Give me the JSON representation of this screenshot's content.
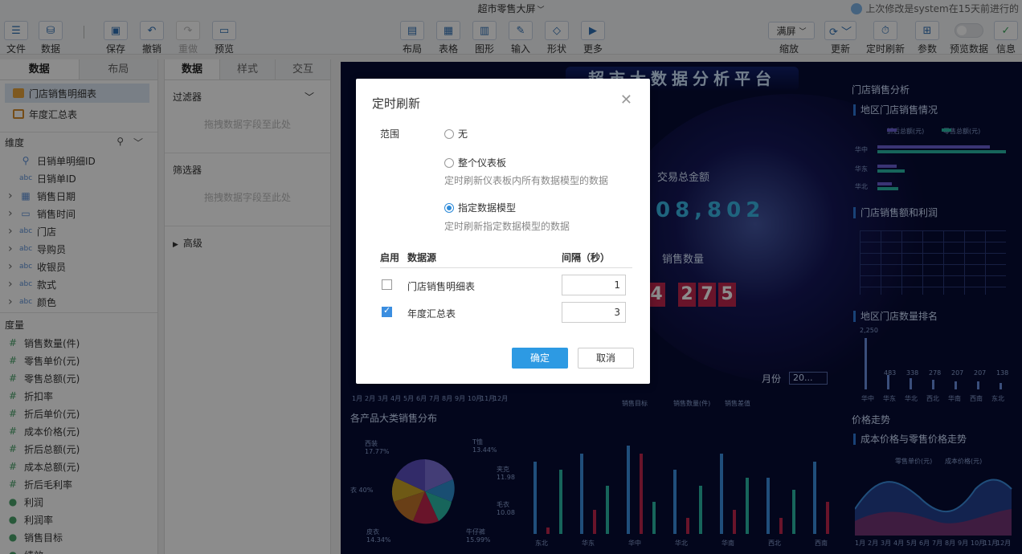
{
  "app_title": "超市零售大屏",
  "last_modified": "上次修改是system在15天前进行的",
  "toolbar_left": [
    {
      "id": "file",
      "label": "文件",
      "icon": "menu-icon"
    },
    {
      "id": "data",
      "label": "数据",
      "icon": "database-icon"
    },
    {
      "id": "save",
      "label": "保存",
      "icon": "save-icon"
    },
    {
      "id": "undo",
      "label": "撤销",
      "icon": "undo-icon"
    },
    {
      "id": "redo",
      "label": "重做",
      "icon": "redo-icon",
      "disabled": true
    },
    {
      "id": "preview",
      "label": "预览",
      "icon": "monitor-icon"
    }
  ],
  "toolbar_mid": [
    {
      "id": "layout",
      "label": "布局"
    },
    {
      "id": "table",
      "label": "表格"
    },
    {
      "id": "chart",
      "label": "图形"
    },
    {
      "id": "input",
      "label": "输入"
    },
    {
      "id": "shape",
      "label": "形状"
    },
    {
      "id": "more",
      "label": "更多"
    }
  ],
  "toolbar_right": {
    "zoom_value": "满屏",
    "zoom_label": "缩放",
    "refresh_label": "更新",
    "timed_refresh_label": "定时刷新",
    "params_label": "参数",
    "preview_data_label": "预览数据",
    "info_label": "信息"
  },
  "left_panel": {
    "tabs": [
      "数据",
      "布局"
    ],
    "datasources": [
      "门店销售明细表",
      "年度汇总表"
    ],
    "dimension_header": "维度",
    "dimensions": [
      {
        "label": "日销单明细ID",
        "type": "key",
        "expand": false
      },
      {
        "label": "日销单ID",
        "type": "abc",
        "expand": false
      },
      {
        "label": "销售日期",
        "type": "date",
        "expand": true
      },
      {
        "label": "销售时间",
        "type": "time",
        "expand": true
      },
      {
        "label": "门店",
        "type": "abc",
        "expand": true
      },
      {
        "label": "导购员",
        "type": "abc",
        "expand": true
      },
      {
        "label": "收银员",
        "type": "abc",
        "expand": true
      },
      {
        "label": "款式",
        "type": "abc",
        "expand": true
      },
      {
        "label": "颜色",
        "type": "abc",
        "expand": true
      }
    ],
    "measure_header": "度量",
    "measures": [
      "销售数量(件)",
      "零售单价(元)",
      "零售总额(元)",
      "折扣率",
      "折后单价(元)",
      "成本价格(元)",
      "折后总额(元)",
      "成本总额(元)",
      "折后毛利率",
      "利润",
      "利润率",
      "销售目标",
      "绩效"
    ],
    "type_abc": "abc"
  },
  "mid_panel": {
    "tabs": [
      "数据",
      "样式",
      "交互"
    ],
    "filter_title": "过滤器",
    "filter_hint": "拖拽数据字段至此处",
    "selector_title": "筛选器",
    "selector_hint": "拖拽数据字段至此处",
    "advanced_title": "高级"
  },
  "dashboard": {
    "title": "超市大数据分析平台",
    "total_amount_label": "交易总金额",
    "total_amount_value": "08,802",
    "sales_qty_label": "销售数量",
    "sales_qty_digits": [
      "4",
      "2",
      "7",
      "5"
    ],
    "store_sales_analysis": "门店销售分析",
    "regional_sales": "地区门店销售情况",
    "legend_discount": "折后总额(元)",
    "legend_retail": "零售总额(元)",
    "regions_short": [
      "华中",
      "华东",
      "华北"
    ],
    "store_sales_profit": "门店销售额和利润",
    "regional_store_rank": "地区门店数量排名",
    "rank_max": "2,250",
    "rank_values": [
      "483",
      "338",
      "278",
      "207",
      "207",
      "138"
    ],
    "rank_regions": [
      "华中",
      "华东",
      "华北",
      "西北",
      "华南",
      "西南",
      "东北"
    ],
    "price_trend": "价格走势",
    "cost_retail_trend": "成本价格与零售价格走势",
    "legend_retail_price": "零售单价(元)",
    "legend_cost_price": "成本价格(元)",
    "trend_months": [
      "1月",
      "2月",
      "3月",
      "4月",
      "5月",
      "6月",
      "7月",
      "8月",
      "9月",
      "10月",
      "11月",
      "12月"
    ],
    "product_sales": "各产品大类销售分布",
    "pie_labels": [
      "T恤 13.44%",
      "夹克 11.98",
      "毛衣 10.08",
      "牛仔裤 15.99%",
      "皮衣 14.34%",
      "衣 40%",
      "西装 17.77%"
    ],
    "month_filter_label": "月份",
    "month_filter_value": "20...",
    "bar_legend": [
      "销售目标",
      "销售数量(件)",
      "销售差值"
    ],
    "bar_regions": [
      "东北",
      "华东",
      "华中",
      "华北",
      "华南",
      "西北",
      "西南"
    ],
    "month_axis": [
      "1月",
      "2月",
      "3月",
      "4月",
      "5月",
      "6月",
      "7月",
      "8月",
      "9月",
      "10月",
      "11月",
      "12月"
    ]
  },
  "modal": {
    "title": "定时刷新",
    "scope_label": "范围",
    "options": [
      {
        "label": "无",
        "desc": "",
        "checked": false
      },
      {
        "label": "整个仪表板",
        "desc": "定时刷新仪表板内所有数据模型的数据",
        "checked": false
      },
      {
        "label": "指定数据模型",
        "desc": "定时刷新指定数据模型的数据",
        "checked": true
      }
    ],
    "col_enable": "启用",
    "col_source": "数据源",
    "col_interval": "间隔（秒）",
    "rows": [
      {
        "name": "门店销售明细表",
        "enabled": false,
        "interval": "1"
      },
      {
        "name": "年度汇总表",
        "enabled": true,
        "interval": "3"
      }
    ],
    "ok_label": "确定",
    "cancel_label": "取消"
  },
  "colors": {
    "accent": "#2d9ae3",
    "dashboard_bg": "#070b33",
    "sales_red": "#c0254e"
  }
}
